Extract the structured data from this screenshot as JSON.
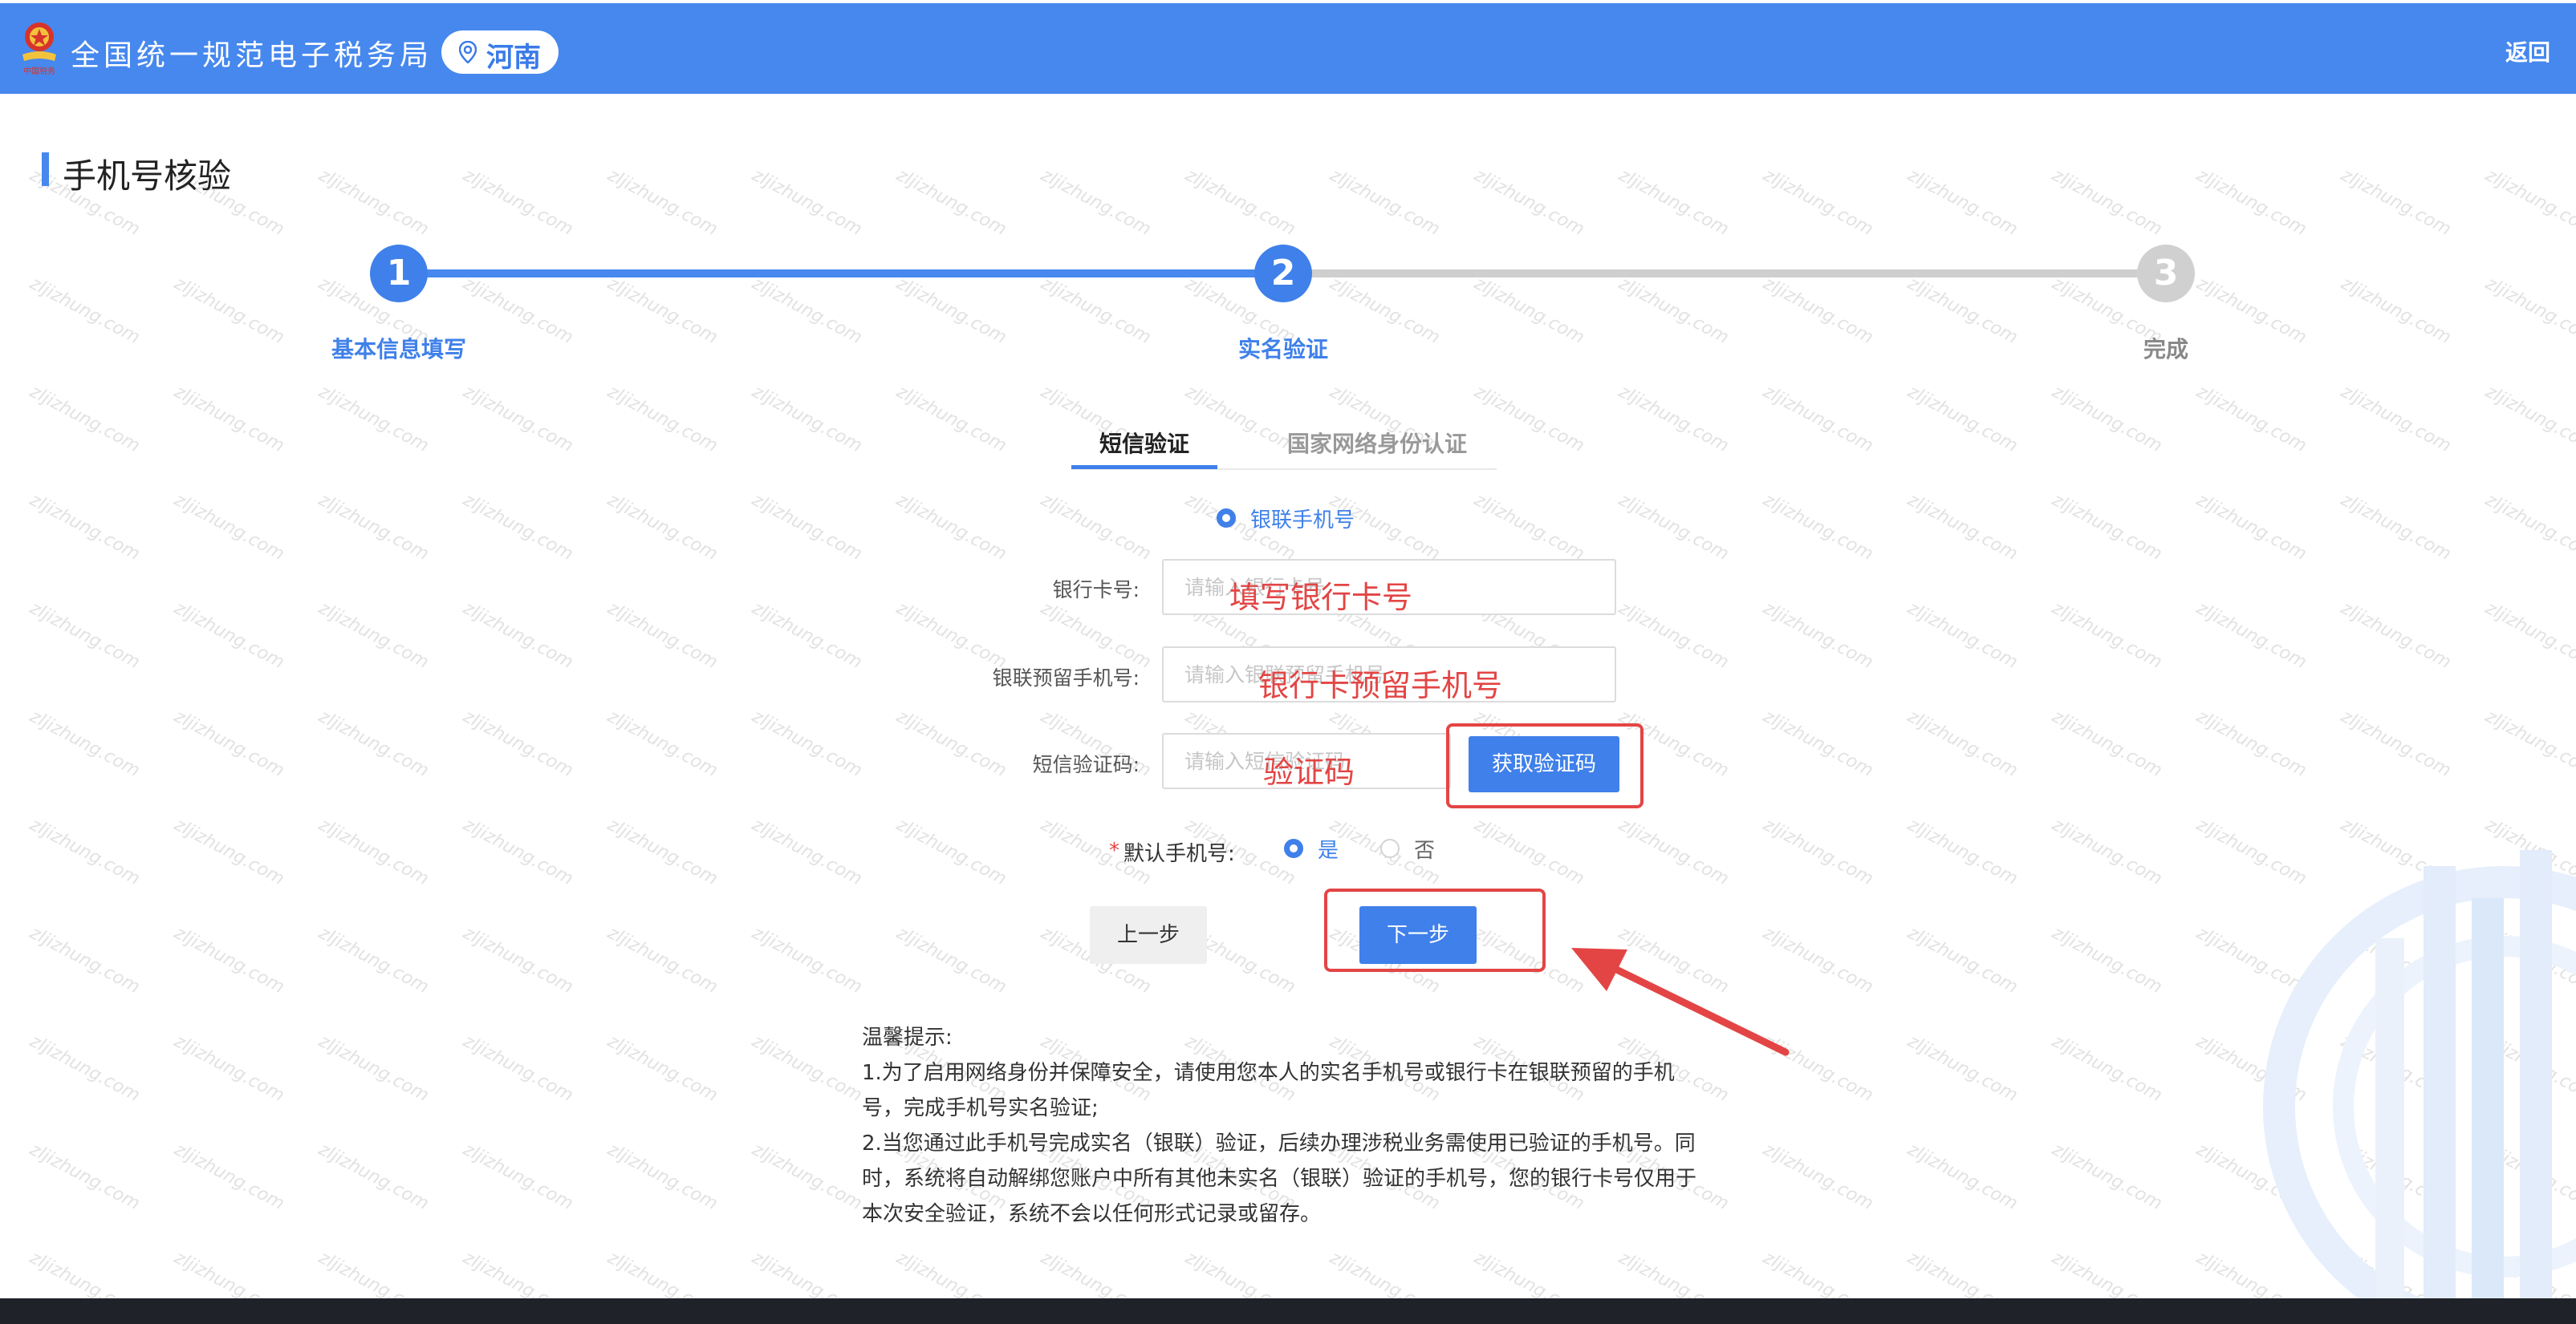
{
  "header": {
    "app_title": "全国统一规范电子税务局",
    "region": "河南",
    "back_label": "返回",
    "logo_text": "中国税务"
  },
  "page": {
    "title": "手机号核验"
  },
  "steps": [
    {
      "num": "1",
      "label": "基本信息填写",
      "state": "done"
    },
    {
      "num": "2",
      "label": "实名验证",
      "state": "active"
    },
    {
      "num": "3",
      "label": "完成",
      "state": "pending"
    }
  ],
  "tabs": {
    "active": "短信验证",
    "inactive": "国家网络身份认证"
  },
  "phone_type": {
    "label": "银联手机号",
    "selected": true
  },
  "form": {
    "bank_card": {
      "label": "银行卡号:",
      "placeholder": "请输入银行卡号",
      "annotation": "填写银行卡号"
    },
    "reserved_phone": {
      "label": "银联预留手机号:",
      "placeholder": "请输入银联预留手机号",
      "annotation": "银行卡预留手机号"
    },
    "sms_code": {
      "label": "短信验证码:",
      "placeholder": "请输入短信验证码",
      "annotation": "验证码",
      "get_code_label": "获取验证码"
    },
    "default_phone": {
      "label": "默认手机号:",
      "yes": "是",
      "no": "否",
      "selected": "是"
    }
  },
  "buttons": {
    "prev": "上一步",
    "next": "下一步"
  },
  "tips": {
    "title": "温馨提示:",
    "lines": [
      "1.为了启用网络身份并保障安全，请使用您本人的实名手机号或银行卡在银联预留的手机号，完成手机号实名验证;",
      "2.当您通过此手机号完成实名（银联）验证，后续办理涉税业务需使用已验证的手机号。同时，系统将自动解绑您账户中所有其他未实名（银联）验证的手机号，您的银行卡号仅用于本次安全验证，系统不会以任何形式记录或留存。"
    ]
  },
  "watermark_text": "zljizhung.com",
  "colors": {
    "primary": "#4688ee",
    "annotation": "#e34545",
    "inactive": "#cfcfcf"
  }
}
